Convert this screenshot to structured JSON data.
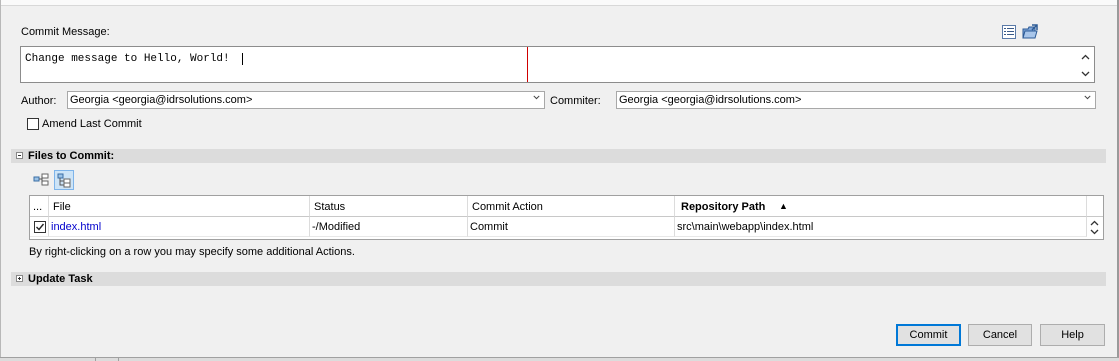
{
  "commit_message": {
    "label": "Commit Message:",
    "text": "Change message to Hello, World!"
  },
  "author": {
    "label": "Author:",
    "value": "Georgia <georgia@idrsolutions.com>"
  },
  "committer": {
    "label": "Commiter:",
    "value": "Georgia <georgia@idrsolutions.com>"
  },
  "amend": {
    "label": "Amend Last Commit",
    "checked": false
  },
  "files_section": {
    "title": "Files to Commit:",
    "columns": [
      "...",
      "File",
      "Status",
      "Commit Action",
      "Repository Path"
    ],
    "sort_column": "Repository Path",
    "sort_indicator": "▲",
    "rows": [
      {
        "checked": true,
        "file": "index.html",
        "status": "-/Modified",
        "action": "Commit",
        "path": "src\\main\\webapp\\index.html"
      }
    ],
    "hint": "By right-clicking on a row you may specify some additional Actions."
  },
  "update_section": {
    "title": "Update Task"
  },
  "buttons": {
    "commit": "Commit",
    "cancel": "Cancel",
    "help": "Help"
  },
  "colors": {
    "link": "#0000cc",
    "default_button_border": "#0078d7",
    "margin_line": "#d00000"
  }
}
